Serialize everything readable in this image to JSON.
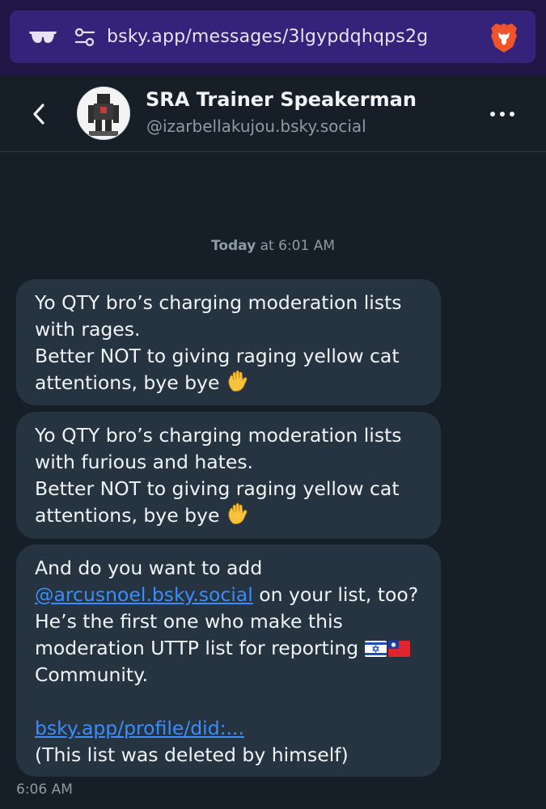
{
  "browser": {
    "url": "bsky.app/messages/3lgypdqhqps2g",
    "icons": [
      "incognito-icon",
      "site-settings-icon",
      "brave-shields-icon"
    ]
  },
  "header": {
    "contact_name": "SRA Trainer Speakerman",
    "contact_handle": "@izarbellakujou.bsky.social",
    "icons": [
      "back-arrow-icon",
      "more-options-icon"
    ]
  },
  "conversation": {
    "date_label_bold": "Today",
    "date_label_rest": " at 6:01 AM",
    "messages": [
      {
        "lines": [
          "Yo QTY bro’s charging moderation lists",
          "with rages.",
          "Better NOT to giving raging yellow cat",
          "attentions, bye bye"
        ],
        "emoji": "waving-hand-icon"
      },
      {
        "lines": [
          "Yo QTY bro’s charging moderation lists",
          "with furious and hates.",
          "Better NOT to giving raging yellow cat",
          "attentions, bye bye"
        ],
        "emoji": "waving-hand-icon"
      },
      {
        "line1": "And do you want to add",
        "mention": "@arcusnoel.bsky.social",
        "line2_rest": " on your list, too?",
        "line3": "He’s the first one who make this",
        "line4": "moderation UTTP list for reporting",
        "flags": [
          "israel-flag-icon",
          "taiwan-flag-icon"
        ],
        "line5": "Community.",
        "link": "bsky.app/profile/did:...",
        "line7": "(This list was deleted by himself)"
      }
    ],
    "last_timestamp": "6:06 AM"
  },
  "colors": {
    "background": "#161e27",
    "bubble": "#263442",
    "link": "#3a8dfb",
    "muted_text": "#8d9aa8",
    "browser_bar": "#1f1645",
    "url_pill": "#35227a"
  }
}
